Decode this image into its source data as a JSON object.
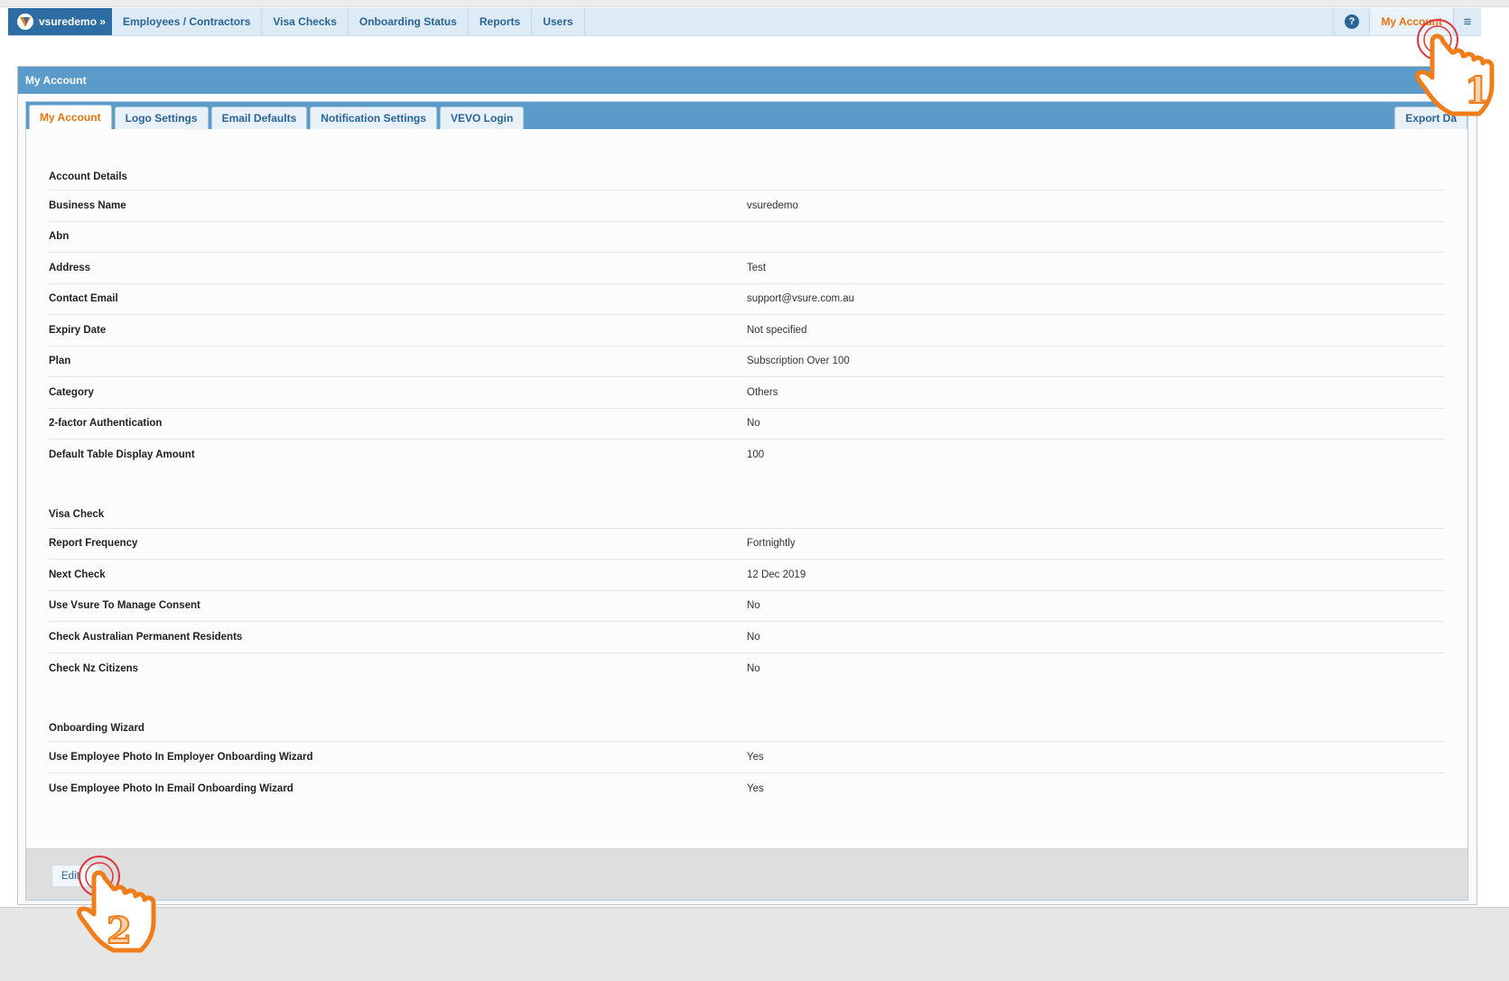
{
  "nav": {
    "brand": "vsuredemo »",
    "items": [
      "Employees / Contractors",
      "Visa Checks",
      "Onboarding Status",
      "Reports",
      "Users"
    ],
    "account": "My Account",
    "help_icon": "question-circle-icon",
    "menu_icon": "hamburger-menu-icon"
  },
  "panel": {
    "title": "My Account",
    "tabs": [
      "My Account",
      "Logo Settings",
      "Email Defaults",
      "Notification Settings",
      "VEVO Login"
    ],
    "export_tab": "Export Da"
  },
  "sections": [
    {
      "title": "Account Details",
      "rows": [
        {
          "label": "Business Name",
          "value": "vsuredemo"
        },
        {
          "label": "Abn",
          "value": ""
        },
        {
          "label": "Address",
          "value": "Test"
        },
        {
          "label": "Contact Email",
          "value": "support@vsure.com.au"
        },
        {
          "label": "Expiry Date",
          "value": "Not specified"
        },
        {
          "label": "Plan",
          "value": "Subscription Over 100"
        },
        {
          "label": "Category",
          "value": "Others"
        },
        {
          "label": "2-factor Authentication",
          "value": "No"
        },
        {
          "label": "Default Table Display Amount",
          "value": "100"
        }
      ]
    },
    {
      "title": "Visa Check",
      "rows": [
        {
          "label": "Report Frequency",
          "value": "Fortnightly"
        },
        {
          "label": "Next Check",
          "value": "12 Dec 2019"
        },
        {
          "label": "Use Vsure To Manage Consent",
          "value": "No"
        },
        {
          "label": "Check Australian Permanent Residents",
          "value": "No"
        },
        {
          "label": "Check Nz Citizens",
          "value": "No"
        }
      ]
    },
    {
      "title": "Onboarding Wizard",
      "rows": [
        {
          "label": "Use Employee Photo In Employer Onboarding Wizard",
          "value": "Yes"
        },
        {
          "label": "Use Employee Photo In Email Onboarding Wizard",
          "value": "Yes"
        }
      ]
    }
  ],
  "footer": {
    "edit_label": "Edit"
  },
  "annotations": {
    "step1": "1",
    "step2": "2",
    "colors": {
      "pointer": "#f07d19",
      "ring": "#e0333a"
    }
  }
}
